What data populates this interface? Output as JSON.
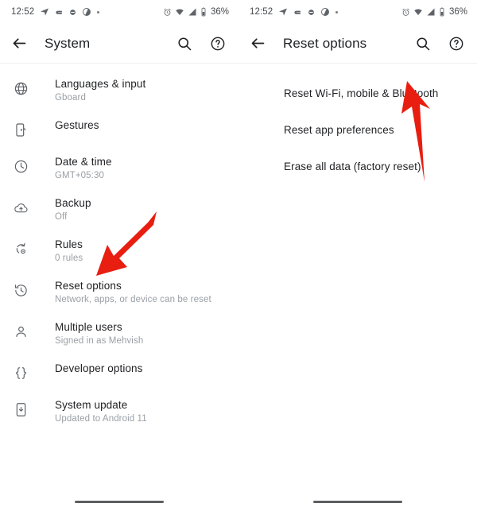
{
  "accent_red": "#E81E11",
  "panels": [
    {
      "status_bar": {
        "time": "12:52",
        "left_icons": [
          "navigation-arrow-icon",
          "hand-icon",
          "circle-icon",
          "partial-circle-icon",
          "dot-icon"
        ],
        "right_icons": [
          "alarm-icon",
          "wifi-icon",
          "signal-icon",
          "battery-icon"
        ],
        "battery": "36%"
      },
      "app_bar": {
        "back": "back-arrow-icon",
        "title": "System",
        "search": "search-icon",
        "help": "help-icon"
      },
      "items": [
        {
          "icon": "globe-icon",
          "title": "Languages & input",
          "subtitle": "Gboard"
        },
        {
          "icon": "gestures-icon",
          "title": "Gestures",
          "subtitle": ""
        },
        {
          "icon": "clock-icon",
          "title": "Date & time",
          "subtitle": "GMT+05:30"
        },
        {
          "icon": "cloud-upload-icon",
          "title": "Backup",
          "subtitle": "Off"
        },
        {
          "icon": "rules-icon",
          "title": "Rules",
          "subtitle": "0 rules"
        },
        {
          "icon": "history-icon",
          "title": "Reset options",
          "subtitle": "Network, apps, or device can be reset"
        },
        {
          "icon": "person-icon",
          "title": "Multiple users",
          "subtitle": "Signed in as Mehvish"
        },
        {
          "icon": "braces-icon",
          "title": "Developer options",
          "subtitle": ""
        },
        {
          "icon": "system-update-icon",
          "title": "System update",
          "subtitle": "Updated to Android 11"
        }
      ]
    },
    {
      "status_bar": {
        "time": "12:52",
        "left_icons": [
          "navigation-arrow-icon",
          "hand-icon",
          "circle-icon",
          "partial-circle-icon",
          "dot-icon"
        ],
        "right_icons": [
          "alarm-icon",
          "wifi-icon",
          "signal-icon",
          "battery-icon"
        ],
        "battery": "36%"
      },
      "app_bar": {
        "back": "back-arrow-icon",
        "title": "Reset options",
        "search": "search-icon",
        "help": "help-icon"
      },
      "items": [
        {
          "icon": "",
          "title": "Reset Wi-Fi, mobile & Bluetooth",
          "subtitle": ""
        },
        {
          "icon": "",
          "title": "Reset app preferences",
          "subtitle": ""
        },
        {
          "icon": "",
          "title": "Erase all data (factory reset)",
          "subtitle": ""
        }
      ]
    }
  ]
}
